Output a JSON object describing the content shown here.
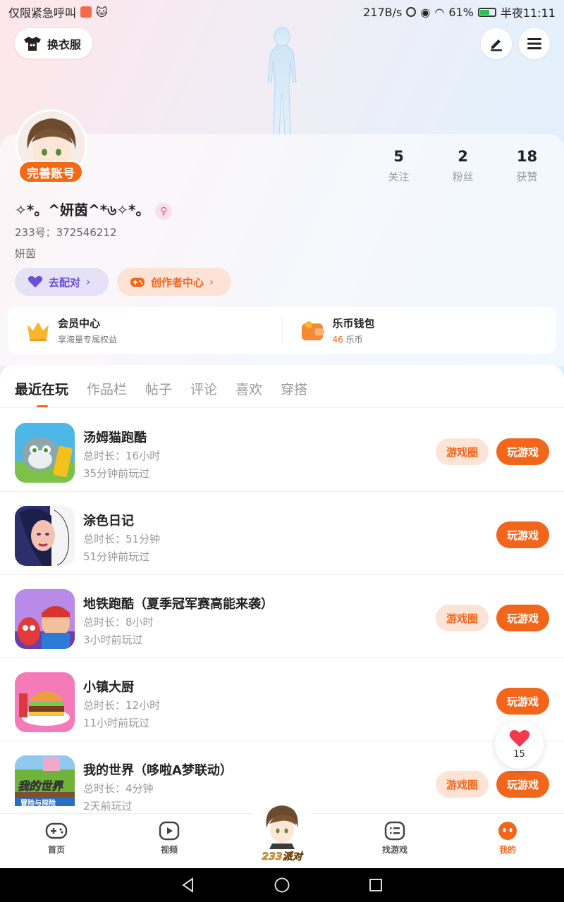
{
  "status_bar": {
    "carrier": "仅限紧急呼叫",
    "speed": "217B/s",
    "battery": "61%",
    "time": "半夜11:11"
  },
  "header": {
    "outfit_label": "换衣服"
  },
  "profile": {
    "complete_badge": "完善账号",
    "nickname": "✧*。^妍茵^*৬✧*。",
    "uid": "233号：372546212",
    "bio": "妍茵",
    "stats": [
      {
        "num": "5",
        "label": "关注"
      },
      {
        "num": "2",
        "label": "粉丝"
      },
      {
        "num": "18",
        "label": "获赞"
      }
    ],
    "match_label": "去配对",
    "creator_label": "创作者中心"
  },
  "member": {
    "title": "会员中心",
    "sub": "享海量专属权益"
  },
  "wallet": {
    "title": "乐币钱包",
    "amount": "46",
    "unit": "乐币"
  },
  "tabs": [
    "最近在玩",
    "作品栏",
    "帖子",
    "评论",
    "喜欢",
    "穿搭"
  ],
  "games": [
    {
      "name": "汤姆猫跑酷",
      "duration": "总时长：16小时",
      "last": "35分钟前玩过",
      "circle": "游戏圈",
      "play": "玩游戏"
    },
    {
      "name": "涂色日记",
      "duration": "总时长：51分钟",
      "last": "51分钟前玩过",
      "circle": "",
      "play": "玩游戏"
    },
    {
      "name": "地铁跑酷（夏季冠军赛高能来袭）",
      "duration": "总时长：8小时",
      "last": "3小时前玩过",
      "circle": "游戏圈",
      "play": "玩游戏"
    },
    {
      "name": "小镇大厨",
      "duration": "总时长：12小时",
      "last": "11小时前玩过",
      "circle": "",
      "play": "玩游戏"
    },
    {
      "name": "我的世界（哆啦A梦联动）",
      "duration": "总时长：4分钟",
      "last": "2天前玩过",
      "circle": "游戏圈",
      "play": "玩游戏"
    }
  ],
  "game_icon_text": {
    "mc_title": "我的世界",
    "mc_sub": "冒险与探险"
  },
  "like_float": {
    "count": "15"
  },
  "bottom_nav": {
    "home": "首页",
    "video": "视频",
    "center": "233派对",
    "find": "找游戏",
    "mine": "我的"
  },
  "colors": {
    "accent": "#f2661c",
    "match": "#6b4fd4"
  }
}
